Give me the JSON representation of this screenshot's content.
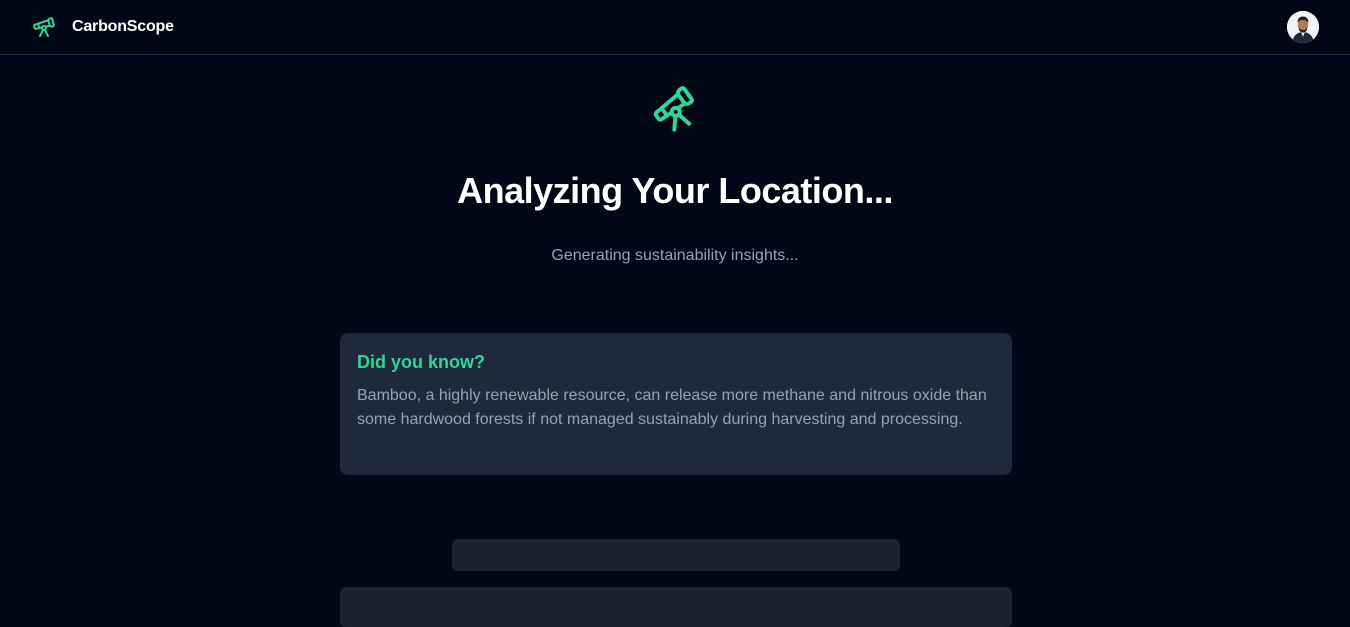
{
  "app": {
    "name": "CarbonScope",
    "logo_icon": "telescope-icon",
    "accent": "#34d399",
    "background": "#020817"
  },
  "header": {
    "avatar_icon": "user-avatar"
  },
  "loading": {
    "icon": "telescope-icon",
    "title": "Analyzing Your Location...",
    "subtitle": "Generating sustainability insights..."
  },
  "fact": {
    "heading": "Did you know?",
    "text": "Bamboo, a highly renewable resource, can release more methane and nitrous oxide than some hardwood forests if not managed sustainably during harvesting and processing."
  }
}
